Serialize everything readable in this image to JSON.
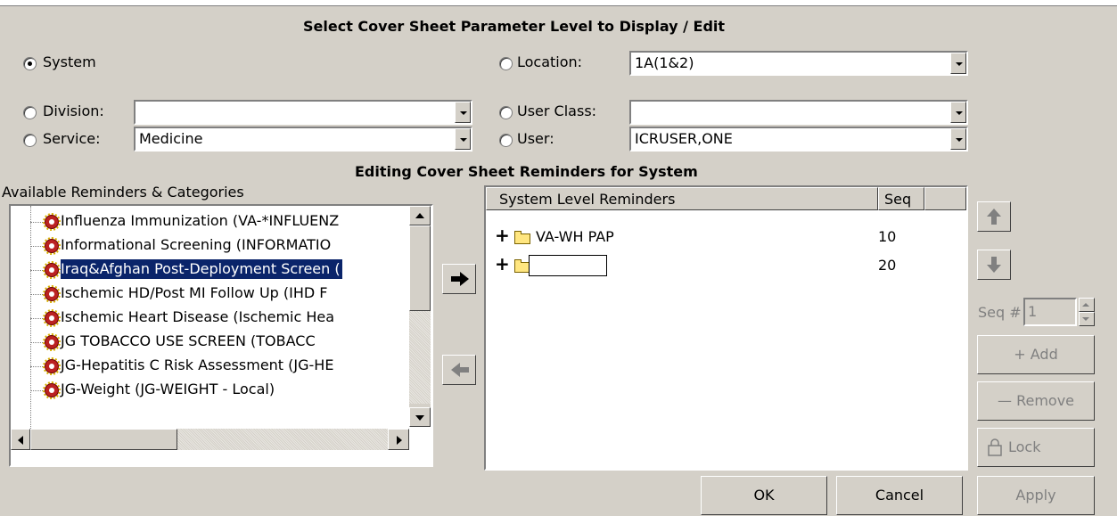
{
  "param_level": {
    "header": "Select Cover Sheet Parameter Level to Display / Edit",
    "system_label": "System",
    "division_label": "Division:",
    "division_value": "",
    "service_label": "Service:",
    "service_value": "Medicine",
    "location_label": "Location:",
    "location_value": "1A(1&2)",
    "user_class_label": "User Class:",
    "user_class_value": "",
    "user_label": "User:",
    "user_value": "ICRUSER,ONE",
    "selected": "System"
  },
  "editing_header": "Editing Cover Sheet Reminders for System",
  "available": {
    "label": "Available Reminders & Categories",
    "items": [
      {
        "text": "Influenza Immunization (VA-*INFLUENZ",
        "selected": false
      },
      {
        "text": "Informational Screening (INFORMATIO",
        "selected": false
      },
      {
        "text": "Iraq&Afghan Post-Deployment Screen (",
        "selected": true
      },
      {
        "text": "Ischemic HD/Post MI Follow Up (IHD F",
        "selected": false
      },
      {
        "text": "Ischemic Heart Disease (Ischemic Hea",
        "selected": false
      },
      {
        "text": "JG TOBACCO USE SCREEN (TOBACC",
        "selected": false
      },
      {
        "text": "JG-Hepatitis C Risk Assessment (JG-HE",
        "selected": false
      },
      {
        "text": "JG-Weight (JG-WEIGHT - Local)",
        "selected": false
      }
    ]
  },
  "system_level": {
    "col_name": "System Level Reminders",
    "col_seq": "Seq",
    "rows": [
      {
        "expander": "+",
        "name": "VA-WH PAP",
        "seq": "10"
      },
      {
        "expander": "+",
        "name": "",
        "seq": "20"
      }
    ]
  },
  "side_controls": {
    "seq_label": "Seq #",
    "seq_value": "1",
    "add_label": "+ Add",
    "remove_label": "— Remove",
    "lock_label": "Lock"
  },
  "footer": {
    "ok_label": "OK",
    "cancel_label": "Cancel",
    "apply_label": "Apply"
  },
  "icons": {
    "move_right": "arrow-right-icon",
    "move_left": "arrow-left-icon",
    "move_up": "arrow-up-icon",
    "move_down": "arrow-down-icon",
    "reminder": "reminder-icon",
    "folder": "folder-icon",
    "lock": "lock-icon"
  },
  "colors": {
    "window_bg": "#d4d0c8",
    "selection_bg": "#0a246a",
    "selection_text": "#ffffff"
  }
}
